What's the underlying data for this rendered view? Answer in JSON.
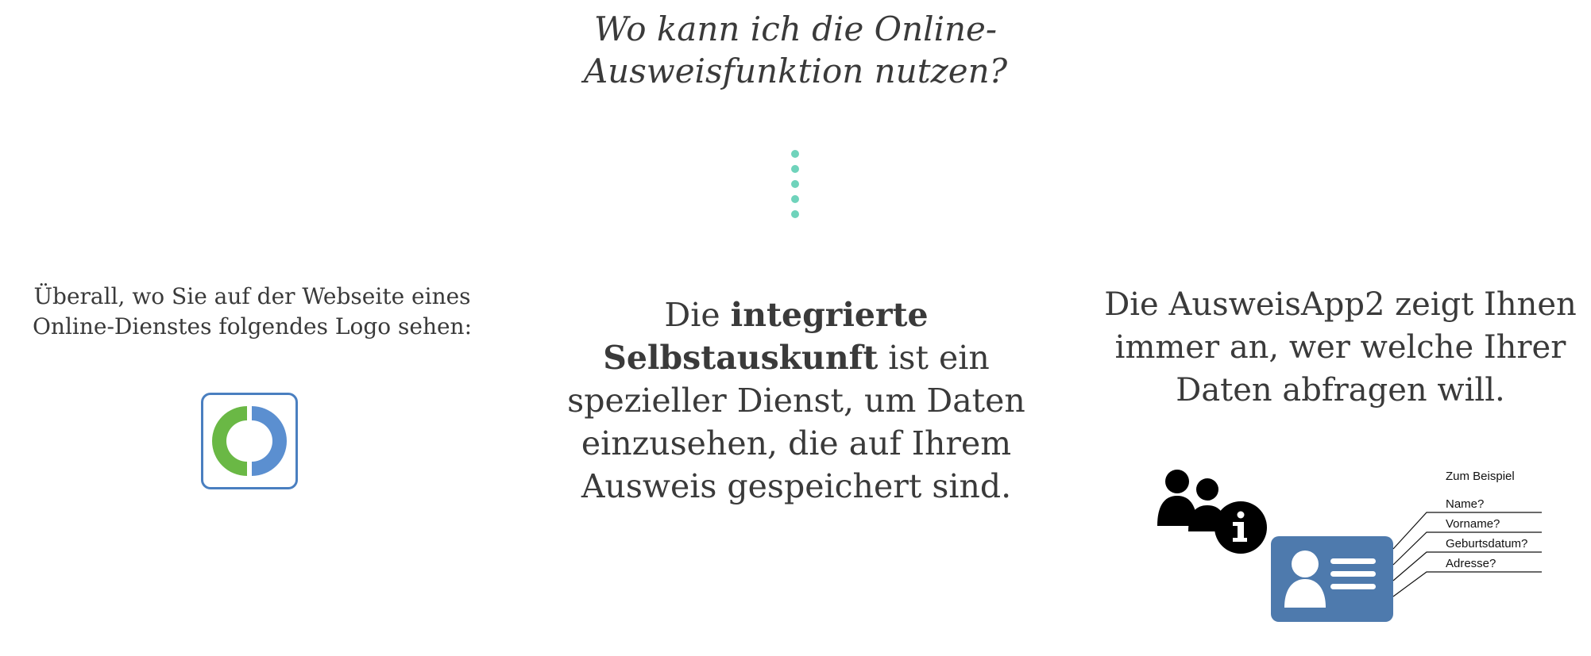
{
  "heading": {
    "line1": "Wo kann ich die Online-",
    "line2": "Ausweisfunktion nutzen?"
  },
  "divider": {
    "dot_count": 5,
    "color": "#6fd3bb"
  },
  "left_column": {
    "text_line1": "Überall, wo Sie auf der Webseite eines",
    "text_line2": "Online-Dienstes folgendes Logo sehen:",
    "logo": {
      "icon": "ausweisapp-logo",
      "border_color": "#4a7fc0",
      "green_color": "#6ab845",
      "blue_color": "#5b8fd0"
    }
  },
  "middle_column": {
    "prefix": "Die ",
    "bold_text": "integrierte Selbstauskunft",
    "rest": " ist ein spezieller Dienst, um Daten einzusehen, die auf Ihrem Ausweis gespeichert sind."
  },
  "right_column": {
    "text_line1": "Die AusweisApp2 zeigt Ihnen",
    "text_line2": "immer an, wer welche Ihrer",
    "text_line3": "Daten abfragen will.",
    "illustration": {
      "example_label": "Zum Beispiel",
      "fields": [
        "Name?",
        "Vorname?",
        "Geburtsdatum?",
        "Adresse?"
      ],
      "card_color": "#4e7aad",
      "icons": [
        "users-icon",
        "info-icon",
        "id-card-icon"
      ]
    }
  }
}
